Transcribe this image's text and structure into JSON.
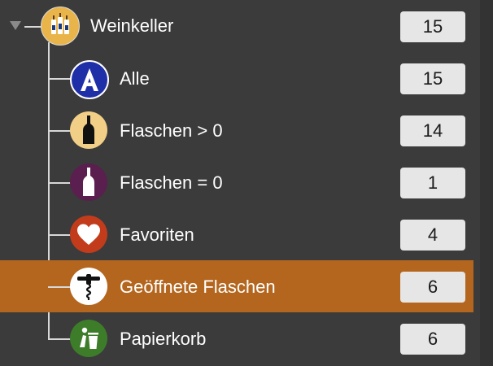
{
  "tree": {
    "root": {
      "label": "Weinkeller",
      "count": "15",
      "icon": "wine-bottles-icon"
    },
    "items": [
      {
        "label": "Alle",
        "count": "15",
        "icon": "letter-a-icon",
        "color": "#1e2fa8"
      },
      {
        "label": "Flaschen > 0",
        "count": "14",
        "icon": "bottle-icon",
        "color": "#f1cf86"
      },
      {
        "label": "Flaschen = 0",
        "count": "1",
        "icon": "empty-bottle-icon",
        "color": "#5a1f4e"
      },
      {
        "label": "Favoriten",
        "count": "4",
        "icon": "heart-icon",
        "color": "#c23c1c"
      },
      {
        "label": "Geöffnete Flaschen",
        "count": "6",
        "icon": "corkscrew-icon",
        "color": "#ffffff",
        "selected": true
      },
      {
        "label": "Papierkorb",
        "count": "6",
        "icon": "trash-icon",
        "color": "#3d7d2a"
      }
    ]
  },
  "colors": {
    "background": "#3b3b3b",
    "selection": "#b4661e",
    "count_badge": "#e6e6e6"
  }
}
